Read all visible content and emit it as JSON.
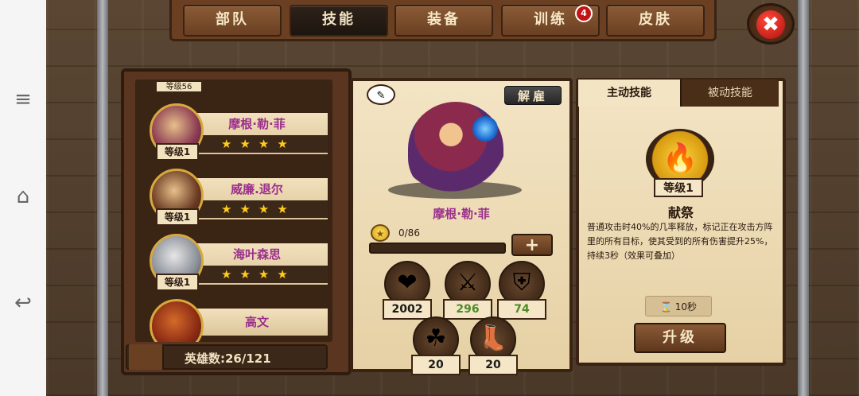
{
  "tabs": [
    {
      "label": "部队"
    },
    {
      "label": "技能"
    },
    {
      "label": "装备"
    },
    {
      "label": "训练",
      "badge": "4"
    },
    {
      "label": "皮肤"
    }
  ],
  "active_tab_index": 1,
  "close_icon": "close-icon",
  "hero_list": {
    "top_partial_level": "等级56",
    "items": [
      {
        "name": "摩根·勒·菲",
        "level": "等级1",
        "stars": "★★★★"
      },
      {
        "name": "威廉.退尔",
        "level": "等级1",
        "stars": "★★★★"
      },
      {
        "name": "海叶森思",
        "level": "等级1",
        "stars": "★★★★"
      },
      {
        "name": "高文",
        "level": "",
        "stars": ""
      }
    ],
    "hero_count": "英雄数:26/121"
  },
  "hero_detail": {
    "dismiss_label": "解雇",
    "name": "摩根·勒·菲",
    "xp": "0/86",
    "xp_fraction": 0,
    "plus_label": "+",
    "stats": [
      {
        "icon": "heart-icon",
        "glyph": "❤",
        "value": "2002",
        "color": "#1b1b1b"
      },
      {
        "icon": "sword-icon",
        "glyph": "⚔",
        "value": "296",
        "color": "#4e8a2a"
      },
      {
        "icon": "shield-icon",
        "glyph": "⛨",
        "value": "74",
        "color": "#4e8a2a"
      },
      {
        "icon": "clover-icon",
        "glyph": "☘",
        "value": "20",
        "color": "#1b1b1b"
      },
      {
        "icon": "boot-icon",
        "glyph": "👢",
        "value": "20",
        "color": "#1b1b1b"
      }
    ]
  },
  "skills": {
    "active_tab": "主动技能",
    "passive_tab": "被动技能",
    "level": "等级1",
    "name": "献祭",
    "description": "普通攻击时40%的几率释放，标记正在攻击方阵里的所有目标，使其受到的所有伤害提升25%，持续3秒（效果可叠加）",
    "cooldown": "10秒",
    "upgrade_label": "升级"
  },
  "colors": {
    "hero_name": "#9b2f8c",
    "star": "#ffcb1f",
    "stat_green": "#4e8a2a"
  }
}
